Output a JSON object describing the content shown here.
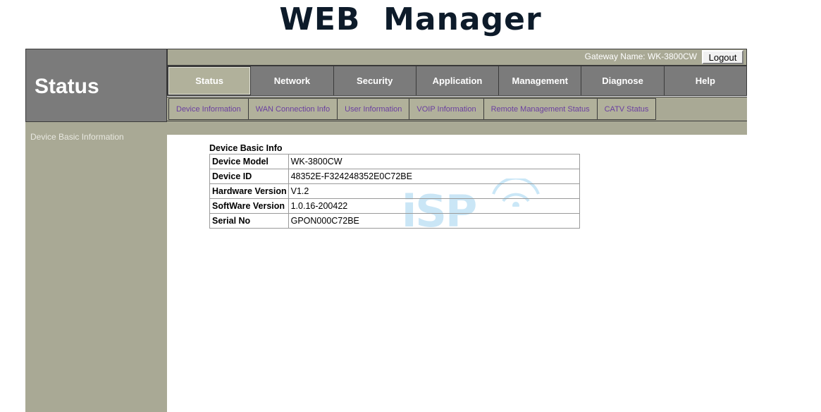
{
  "page": {
    "title": "WEB  Manager"
  },
  "topbar": {
    "gateway_label": "Gateway Name: WK-3800CW",
    "logout_label": "Logout"
  },
  "sidebar": {
    "heading": "Status",
    "links": [
      {
        "label": "Device Basic Information"
      }
    ]
  },
  "main_tabs": [
    {
      "label": "Status",
      "active": true
    },
    {
      "label": "Network",
      "active": false
    },
    {
      "label": "Security",
      "active": false
    },
    {
      "label": "Application",
      "active": false
    },
    {
      "label": "Management",
      "active": false
    },
    {
      "label": "Diagnose",
      "active": false
    },
    {
      "label": "Help",
      "active": false
    }
  ],
  "sub_tabs": [
    {
      "label": "Device Information"
    },
    {
      "label": "WAN Connection Info"
    },
    {
      "label": "User Information"
    },
    {
      "label": "VOIP Information"
    },
    {
      "label": "Remote Management Status"
    },
    {
      "label": "CATV Status"
    }
  ],
  "content": {
    "caption": "Device Basic Info",
    "rows": [
      {
        "label": "Device Model",
        "value": "WK-3800CW"
      },
      {
        "label": "Device ID",
        "value": "48352E-F324248352E0C72BE"
      },
      {
        "label": "Hardware Version",
        "value": "V1.2"
      },
      {
        "label": "SoftWare Version",
        "value": "1.0.16-200422"
      },
      {
        "label": "Serial No",
        "value": "GPON000C72BE"
      }
    ],
    "watermark": "iSP"
  },
  "colors": {
    "khaki": "#a9a995",
    "khaki_light": "#b1b19b",
    "gray": "#7b7b7b",
    "sub_tab_text": "#6a3fa0",
    "watermark": "#9fd3f0",
    "title": "#0d1b2a"
  }
}
